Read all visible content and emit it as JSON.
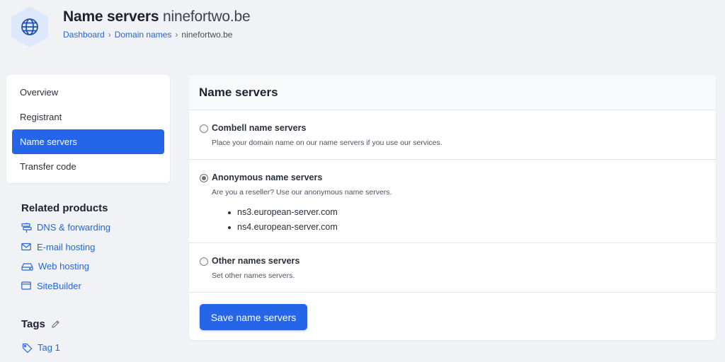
{
  "header": {
    "title": "Name servers",
    "domain": "ninefortwo.be",
    "breadcrumb": [
      "Dashboard",
      "Domain names",
      "ninefortwo.be"
    ],
    "icon": "globe-icon"
  },
  "sidebar": {
    "items": [
      {
        "label": "Overview",
        "active": false
      },
      {
        "label": "Registrant",
        "active": false
      },
      {
        "label": "Name servers",
        "active": true
      },
      {
        "label": "Transfer code",
        "active": false
      }
    ]
  },
  "related": {
    "title": "Related products",
    "items": [
      {
        "label": "DNS & forwarding",
        "icon": "signpost-icon"
      },
      {
        "label": "E-mail hosting",
        "icon": "envelope-icon"
      },
      {
        "label": "Web hosting",
        "icon": "server-icon"
      },
      {
        "label": "SiteBuilder",
        "icon": "browser-window-icon"
      }
    ]
  },
  "tags": {
    "title": "Tags",
    "items": [
      "Tag 1"
    ]
  },
  "main": {
    "title": "Name servers",
    "options": [
      {
        "label": "Combell name servers",
        "description": "Place your domain name on our name servers if you use our services.",
        "selected": false
      },
      {
        "label": "Anonymous name servers",
        "description": "Are you a reseller? Use our anonymous name servers.",
        "selected": true,
        "servers": [
          "ns3.european-server.com",
          "ns4.european-server.com"
        ]
      },
      {
        "label": "Other names servers",
        "description": "Set other names servers.",
        "selected": false
      }
    ],
    "save_label": "Save name servers"
  },
  "colors": {
    "accent": "#2565e8",
    "link": "#2566d6",
    "background": "#f1f2f6",
    "hexagon": "#dde9fb"
  }
}
